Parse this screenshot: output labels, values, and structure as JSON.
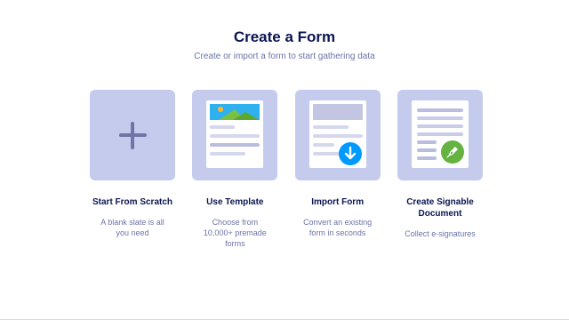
{
  "header": {
    "title": "Create a Form",
    "subtitle": "Create or import a form to start gathering data"
  },
  "cards": [
    {
      "label": "Start From Scratch",
      "description": "A blank slate is all you need",
      "icon": "plus-icon"
    },
    {
      "label": "Use Template",
      "description": "Choose from 10,000+ premade forms",
      "icon": "template-document-icon"
    },
    {
      "label": "Import Form",
      "description": "Convert an existing form in seconds",
      "icon": "import-document-icon"
    },
    {
      "label": "Create Signable Document",
      "description": "Collect e-signatures",
      "icon": "signature-document-icon"
    }
  ],
  "colors": {
    "tile_background": "#c5cbed",
    "title": "#0a1551",
    "subtitle": "#6c73a8",
    "plus": "#6f76a7",
    "import_badge": "#0099ff",
    "signature_badge": "#64b23f"
  }
}
